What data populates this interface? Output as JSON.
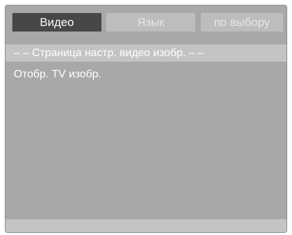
{
  "tabs": [
    {
      "label": "Видео",
      "active": true
    },
    {
      "label": "Язык",
      "active": false
    },
    {
      "label": "по выбору",
      "active": false
    }
  ],
  "page": {
    "header": "– – Страница настр. видео изобр. – –",
    "items": [
      {
        "label": "Отобр. TV изобр."
      }
    ]
  },
  "colors": {
    "panel": "#a8a8a8",
    "active_tab": "#474747",
    "inactive_tab": "#bdbdbd",
    "header_bar": "#c4c4c4",
    "text": "#ffffff"
  }
}
